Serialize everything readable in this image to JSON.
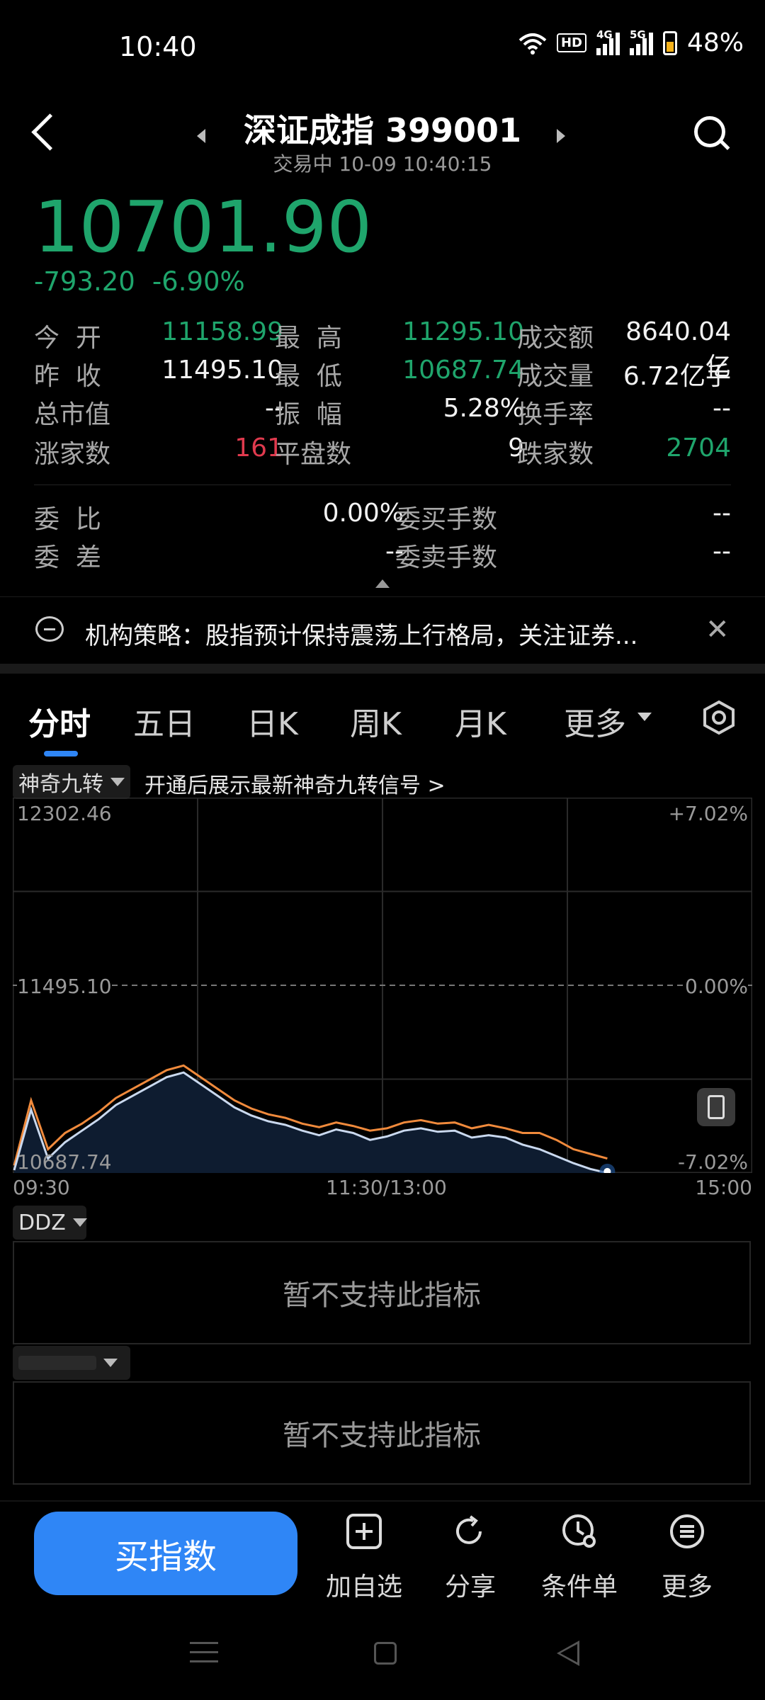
{
  "status_bar": {
    "time": "10:40",
    "hd_label": "HD",
    "net1": "4G",
    "net2": "5G",
    "battery": "48%"
  },
  "header": {
    "title": "深证成指 399001",
    "subtitle": "交易中 10-09 10:40:15"
  },
  "quote": {
    "price": "10701.90",
    "change": "-793.20",
    "change_pct": "-6.90%"
  },
  "stats": {
    "open_label": "今  开",
    "open": "11158.99",
    "high_label": "最  高",
    "high": "11295.10",
    "amount_label": "成交额",
    "amount": "8640.04亿",
    "prev_close_label": "昨  收",
    "prev_close": "11495.10",
    "low_label": "最  低",
    "low": "10687.74",
    "volume_label": "成交量",
    "volume": "6.72亿手",
    "mktcap_label": "总市值",
    "mktcap": "--",
    "amplitude_label": "振  幅",
    "amplitude": "5.28%",
    "turnover_label": "换手率",
    "turnover": "--",
    "up_label": "涨家数",
    "up": "161",
    "flat_label": "平盘数",
    "flat": "9",
    "down_label": "跌家数",
    "down": "2704",
    "wei_bi_label": "委  比",
    "wei_bi": "0.00%",
    "wei_buy_label": "委买手数",
    "wei_buy": "--",
    "wei_cha_label": "委  差",
    "wei_cha": "--",
    "wei_sell_label": "委卖手数",
    "wei_sell": "--"
  },
  "news": {
    "text": "机构策略：股指预计保持震荡上行格局，关注证券..."
  },
  "tabs": [
    "分时",
    "五日",
    "日K",
    "周K",
    "月K",
    "更多"
  ],
  "indicator": {
    "selected": "神奇九转",
    "hint": "开通后展示最新神奇九转信号 >"
  },
  "chart_data": {
    "type": "line",
    "y_left_ticks": [
      "12302.46",
      "11495.10",
      "10687.74"
    ],
    "y_right_ticks": [
      "+7.02%",
      "0.00%",
      "-7.02%"
    ],
    "x_ticks": [
      "09:30",
      "11:30/13:00",
      "15:00"
    ],
    "ylim": [
      10687.74,
      12302.46
    ],
    "reference": 11495.1,
    "series": [
      {
        "values": [
          10720,
          11000,
          10790,
          10860,
          10900,
          10950,
          11010,
          11050,
          11090,
          11130,
          11150,
          11100,
          11050,
          11000,
          10965,
          10940,
          10925,
          10900,
          10885,
          10905,
          10890,
          10870,
          10880,
          10905,
          10915,
          10900,
          10905,
          10880,
          10895,
          10880,
          10860,
          10860,
          10830,
          10790,
          10770,
          10750
        ]
      },
      {
        "values": [
          10700,
          10960,
          10750,
          10820,
          10870,
          10920,
          10980,
          11020,
          11060,
          11100,
          11120,
          11070,
          11020,
          10970,
          10935,
          10910,
          10895,
          10870,
          10850,
          10875,
          10860,
          10830,
          10845,
          10870,
          10880,
          10865,
          10870,
          10840,
          10850,
          10840,
          10810,
          10790,
          10760,
          10730,
          10705,
          10688
        ]
      }
    ],
    "colors": {
      "avg": "#f08a3c",
      "price": "#c9d8ee",
      "fill": "#0e1c30",
      "end_dot": "#2f86f6"
    }
  },
  "ddz": {
    "label": "DDZ",
    "message": "暂不支持此指标"
  },
  "second_panel": {
    "message": "暂不支持此指标"
  },
  "actions": {
    "buy": "买指数",
    "watchlist": "加自选",
    "share": "分享",
    "condition": "条件单",
    "more": "更多"
  }
}
